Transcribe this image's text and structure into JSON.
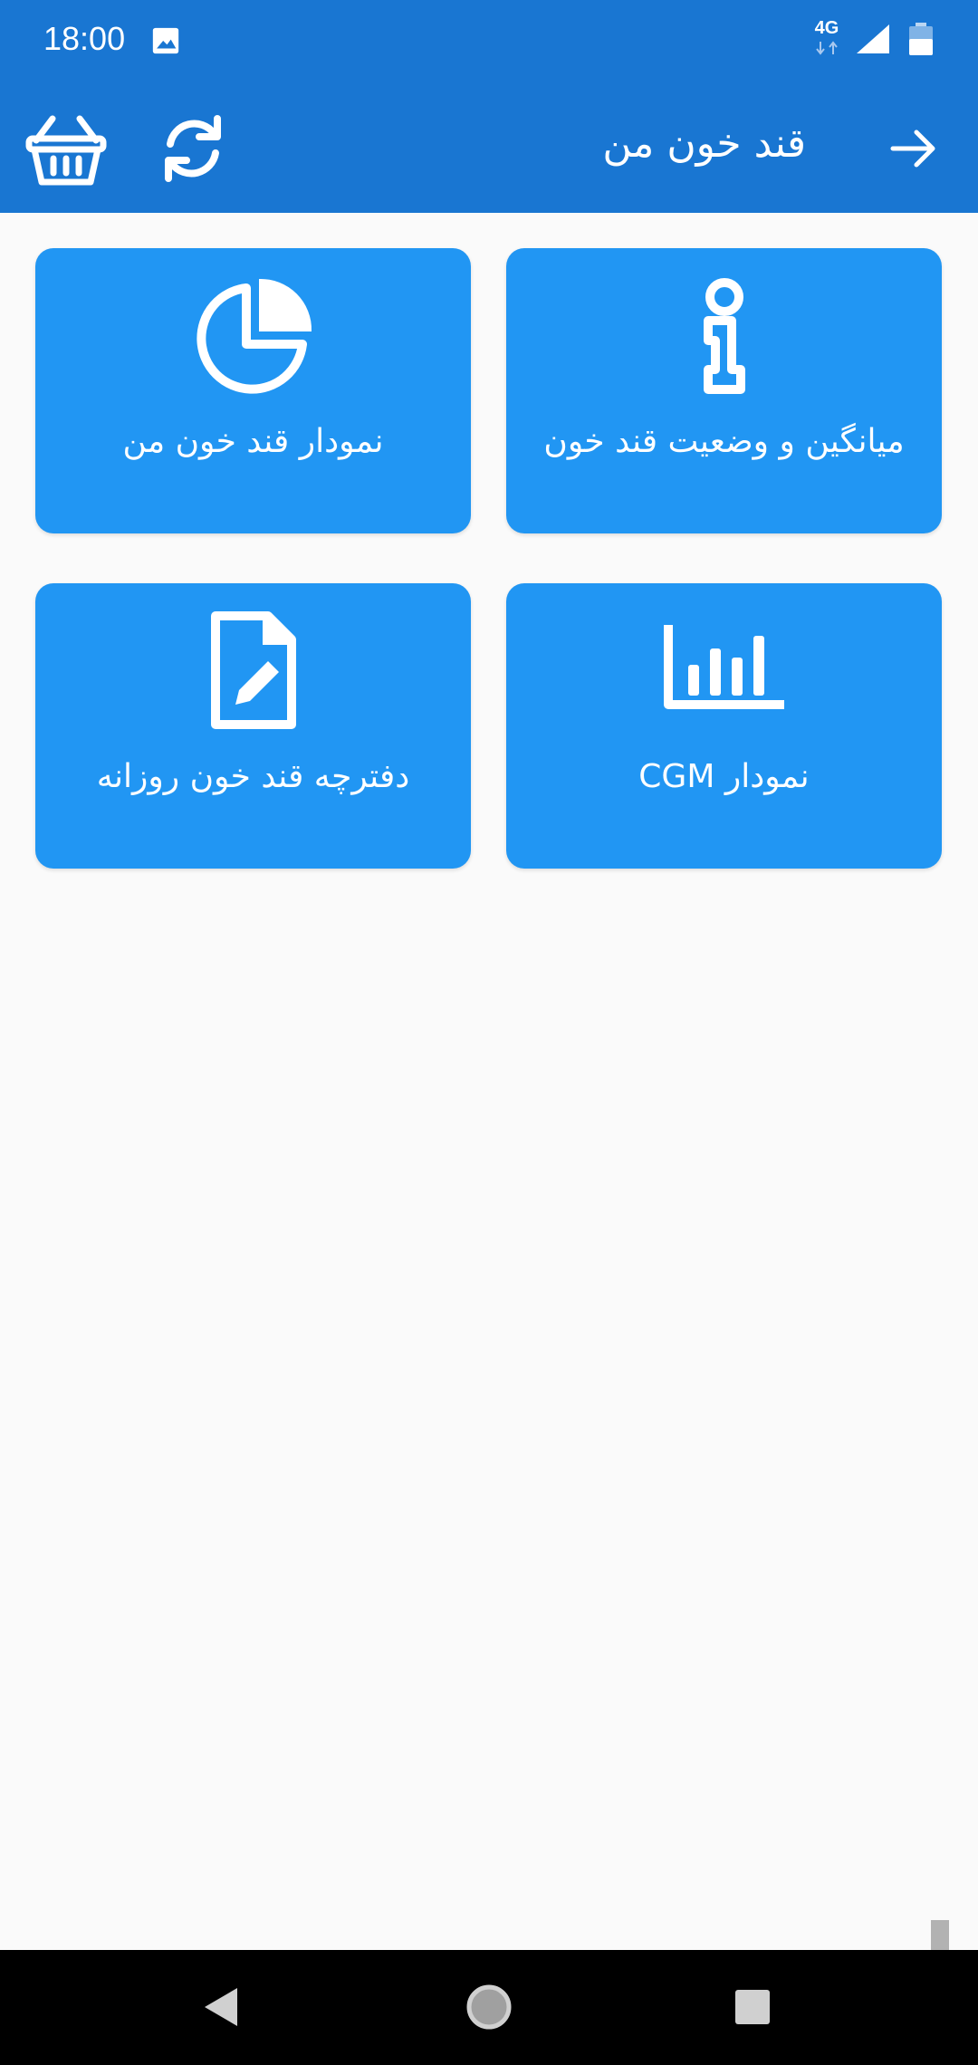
{
  "status_bar": {
    "time": "18:00",
    "network": "4G",
    "icons": [
      "gallery-icon",
      "network-4g-icon",
      "signal-icon",
      "battery-icon"
    ]
  },
  "toolbar": {
    "title": "قند خون من",
    "icons": [
      "basket-icon",
      "refresh-icon",
      "arrow-back-icon"
    ]
  },
  "cards": [
    {
      "label": "میانگین و وضعیت قند خون",
      "icon": "info-icon"
    },
    {
      "label": "نمودار قند خون من",
      "icon": "pie-chart-icon"
    },
    {
      "label": "نمودار CGM",
      "icon": "bar-chart-icon"
    },
    {
      "label": "دفترچه قند خون روزانه",
      "icon": "edit-document-icon"
    }
  ],
  "nav_bar": {
    "icons": [
      "nav-back-icon",
      "nav-home-icon",
      "nav-recent-icon"
    ]
  },
  "colors": {
    "app_bar": "#1976d2",
    "card": "#2196f3",
    "background": "#fafafa",
    "nav_bar": "#000000"
  }
}
